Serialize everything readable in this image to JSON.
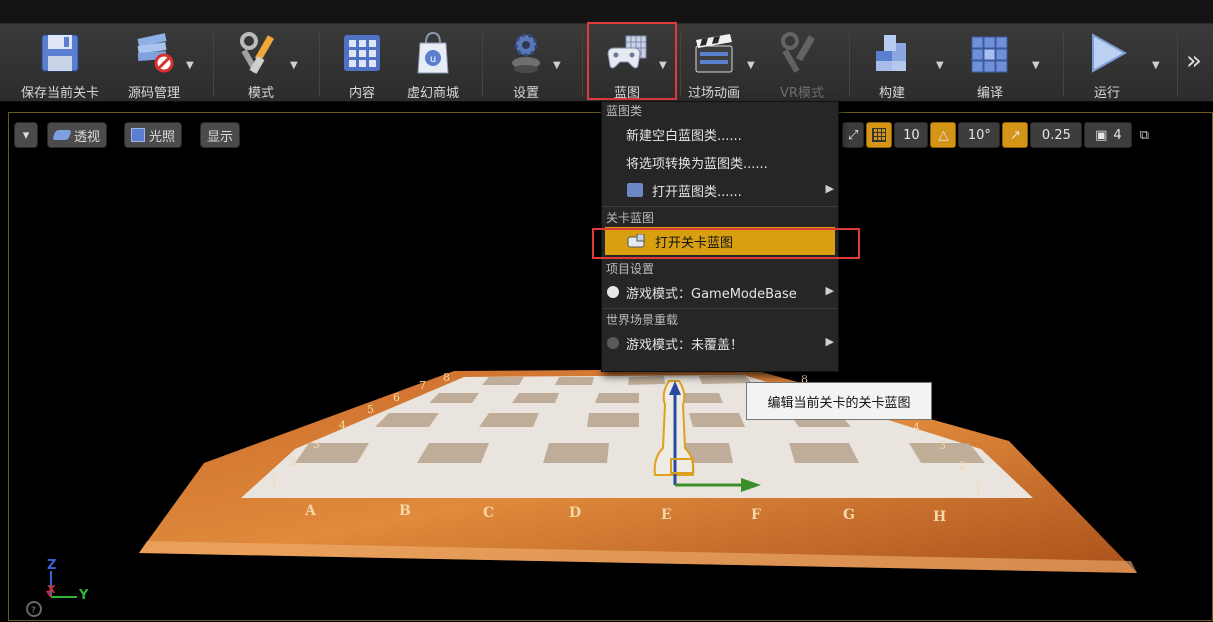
{
  "toolbar": {
    "save": "保存当前关卡",
    "source_control": "源码管理",
    "modes": "模式",
    "content": "内容",
    "marketplace": "虚幻商城",
    "settings": "设置",
    "blueprints": "蓝图",
    "cinematics": "过场动画",
    "vr_mode": "VR模式",
    "build": "构建",
    "compile": "编译",
    "play": "运行",
    "more": "»"
  },
  "viewport": {
    "perspective": "透视",
    "lit": "光照",
    "show": "显示",
    "grid_snap": "10",
    "rotation_snap": "10°",
    "scale_snap": "0.25",
    "camera_speed": "4"
  },
  "blueprint_menu": {
    "section_blueprint_classes": "蓝图类",
    "new_empty_blueprint": "新建空白蓝图类......",
    "convert_selection": "将选项转换为蓝图类......",
    "open_blueprint_class": "打开蓝图类......",
    "section_level_blueprint": "关卡蓝图",
    "open_level_blueprint": "打开关卡蓝图",
    "section_project_settings": "项目设置",
    "game_mode_project": "游戏模式：GameModeBase",
    "section_world_override": "世界场景重载",
    "game_mode_world": "游戏模式：未覆盖！"
  },
  "tooltip": "编辑当前关卡的关卡蓝图",
  "board": {
    "files": [
      "A",
      "B",
      "C",
      "D",
      "E",
      "F",
      "G",
      "H"
    ],
    "left_ranks": [
      "1",
      "2",
      "3",
      "4",
      "5",
      "6",
      "7",
      "8"
    ],
    "right_ranks": [
      "1",
      "2",
      "3",
      "4",
      "5",
      "6",
      "7",
      "8"
    ]
  },
  "axes": {
    "z": "Z",
    "x": "X",
    "y": "Y"
  },
  "colors": {
    "accent_orange": "#d8a010",
    "highlight_red": "#e03b3b"
  }
}
